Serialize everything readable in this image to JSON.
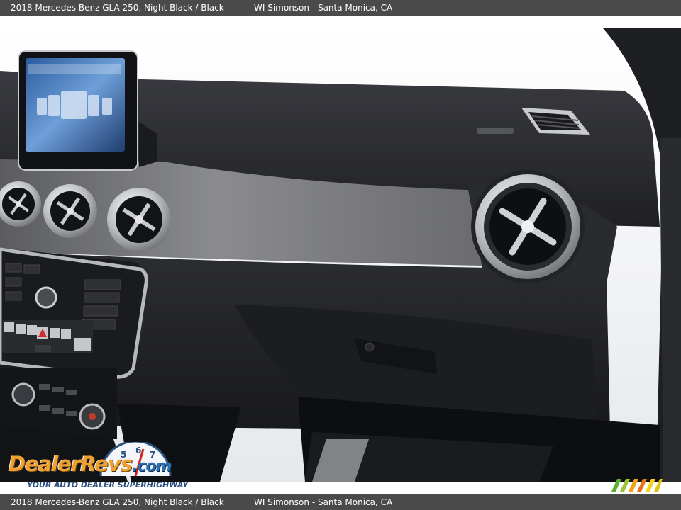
{
  "caption": {
    "vehicle": "2018 Mercedes-Benz GLA 250,  Night Black / Black",
    "dealer": "WI Simonson - Santa Monica, CA"
  },
  "photo": {
    "subject": "dashboard"
  },
  "watermark": {
    "logo_text": "DealerRevs.com",
    "tagline": "YOUR AUTO DEALER SUPERHIGHWAY"
  },
  "colors": {
    "caption_bar": "#4a4a4a",
    "dashboard": "#2b2c30",
    "trim": "#77787b",
    "chrome": "#d9dadd"
  }
}
